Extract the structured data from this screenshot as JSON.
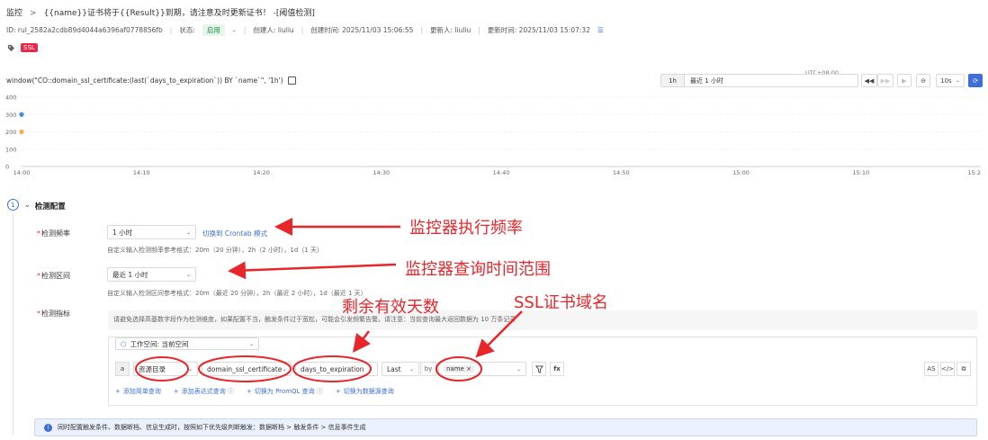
{
  "header": {
    "breadcrumb_root": "监控",
    "breadcrumb_sep": ">",
    "title": "{{name}}证书将于{{Result}}到期，请注意及时更新证书！ -[阈值检测]"
  },
  "meta": {
    "id": "ID: rul_2582a2cdb89d4044a6396af0778856fb",
    "status_label": "状态:",
    "status_value": "启用",
    "creator": "创建人: liuliu",
    "created": "创建时间: 2025/11/03 15:06:55",
    "updater": "更新人: liuliu",
    "updated": "更新时间: 2025/11/03 15:07:32"
  },
  "tags": [
    "SSL"
  ],
  "query_bar": {
    "expression": "window(\"CO::domain_ssl_certificate:(last(`days_to_expiration`)) BY `name`\", '1h')",
    "utc": "UTC+08:00",
    "range_prefix": "1h",
    "range_value": "最近 1 小时",
    "interval": "10s"
  },
  "chart_data": {
    "type": "scatter",
    "x_ticks": [
      "14:00",
      "14:10",
      "14:20",
      "14:30",
      "14:40",
      "14:50",
      "15:00",
      "15:10",
      "15:2"
    ],
    "y_ticks": [
      "400",
      "300",
      "200",
      "100",
      "0"
    ],
    "ylim": [
      0,
      400
    ],
    "series": [
      {
        "color": "#3d8fe0",
        "x": "14:00",
        "y": 300
      },
      {
        "color": "#f0b042",
        "x": "14:00",
        "y": 200
      }
    ]
  },
  "section": {
    "step": "1",
    "title": "检测配置"
  },
  "frequency": {
    "label": "检测频率",
    "value": "1 小时",
    "switch_link": "切换到 Crontab 模式",
    "hint": "自定义输入检测频率参考格式：20m（20 分钟），2h（2 小时），1d（1 天）"
  },
  "interval": {
    "label": "检测区间",
    "value": "最近 1 小时",
    "hint": "自定义输入检测区间参考格式：20m（最近 20 分钟），2h（最近 2 小时），1d（最近 1 天）"
  },
  "metric": {
    "label": "检测指标",
    "notice": "请避免选择高基数字段作为检测维度，如果配置不当，触发条件过于宽松，可能会引发频繁告警。请注意：当前查询最大返回数据为 10 万条记录",
    "workspace": "工作空间: 当前空间",
    "letter": "a",
    "source": "资源目录",
    "dataset": "domain_ssl_certificate",
    "field": "days_to_expiration",
    "agg": "Last",
    "by": "by",
    "group_chip": "name",
    "filter_btn": "⚲",
    "fx_btn": "fx",
    "as_btn": "AS",
    "code_btn": "</>",
    "copy_btn": "⧉",
    "add_simple": "添加简单查询",
    "add_expr": "添加表达式查询",
    "switch_promql": "切换为 PromQL 查询",
    "switch_source": "切换为数据源查询"
  },
  "info": "同时配置触发条件、数据断档、信息生成时，按照如下优先级判断触发：数据断档 > 触发条件 > 信息事件生成",
  "annotations": {
    "freq": "监控器执行频率",
    "range": "监控器查询时间范围",
    "days": "剩余有效天数",
    "domain": "SSL证书域名"
  },
  "colors": {
    "accent": "#3d6fd6",
    "annotation": "#e8262a",
    "tag": "#e8294a"
  }
}
